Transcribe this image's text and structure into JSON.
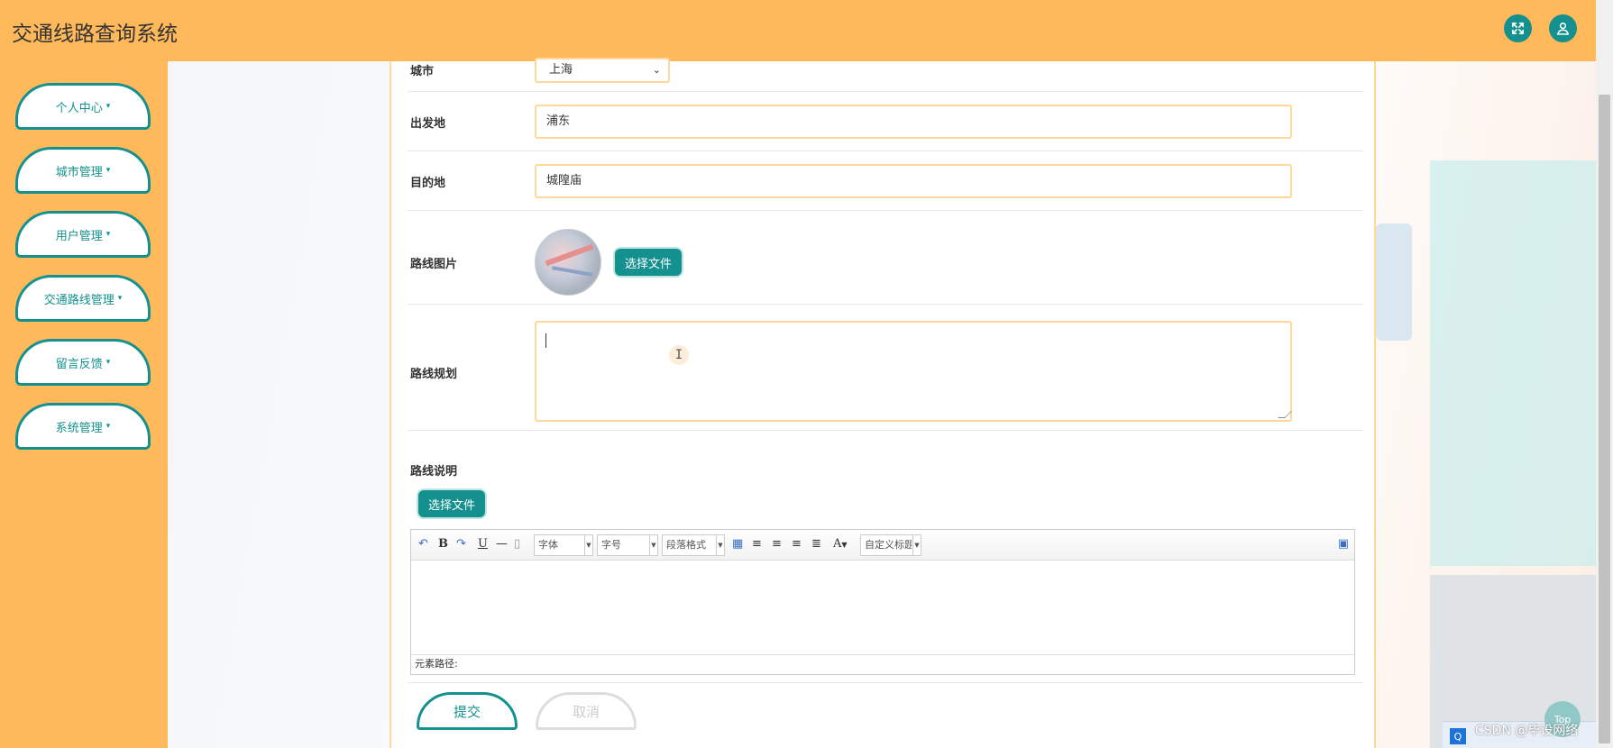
{
  "app": {
    "title": "交通线路查询系统"
  },
  "header": {
    "fullscreen_icon": "expand-icon",
    "user_icon": "user-icon"
  },
  "sidebar": {
    "items": [
      {
        "label": "个人中心"
      },
      {
        "label": "城市管理"
      },
      {
        "label": "用户管理"
      },
      {
        "label": "交通路线管理"
      },
      {
        "label": "留言反馈"
      },
      {
        "label": "系统管理"
      }
    ]
  },
  "form": {
    "city": {
      "label": "城市",
      "value": "上海"
    },
    "origin": {
      "label": "出发地",
      "value": "浦东"
    },
    "destination": {
      "label": "目的地",
      "value": "城隍庙"
    },
    "route_image": {
      "label": "路线图片",
      "button": "选择文件"
    },
    "route_plan": {
      "label": "路线规划",
      "value": ""
    },
    "route_desc": {
      "label": "路线说明",
      "button": "选择文件"
    }
  },
  "editor": {
    "font_family": "字体",
    "font_size": "字号",
    "paragraph": "段落格式",
    "custom_title": "自定义标题",
    "text_color_glyph": "A",
    "element_path": "元素路径:"
  },
  "actions": {
    "submit": "提交",
    "cancel": "取消"
  },
  "overlay": {
    "watermark": "CSDN @毕设网络",
    "top_button": "Top"
  },
  "colors": {
    "accent": "#14918f",
    "header_bg": "#ffb95a",
    "field_border": "#ffd89a"
  }
}
